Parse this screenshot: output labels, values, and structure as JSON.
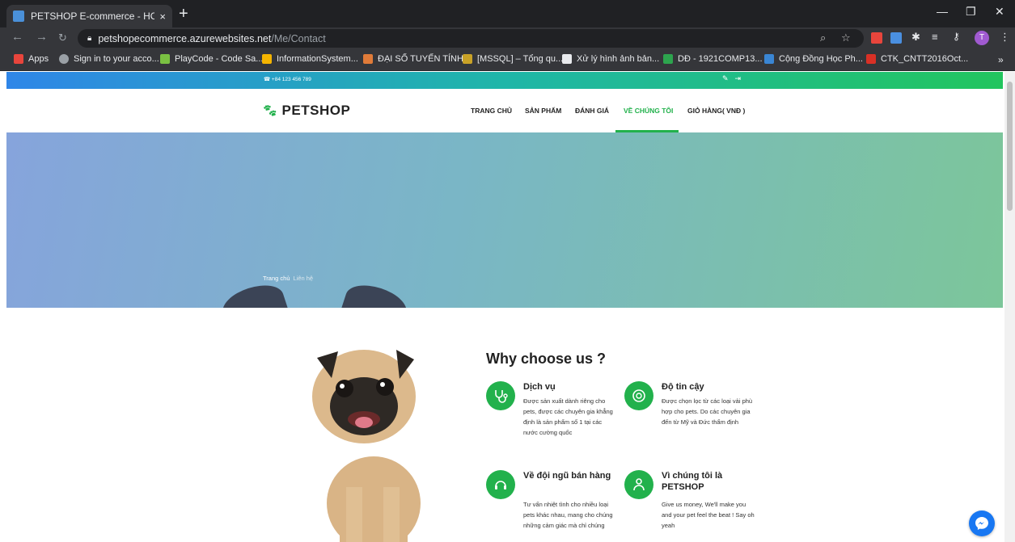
{
  "browser": {
    "tab_title": "PETSHOP E-commerce - HCMUE",
    "tab_close": "×",
    "new_tab": "+",
    "url_host": "petshopecommerce.azurewebsites.net",
    "url_path": "/Me/Contact",
    "window_min": "—",
    "window_max": "❐",
    "window_close": "✕",
    "avatar_letter": "T",
    "bookmarks": [
      {
        "label": "Apps",
        "color": "#e8453c"
      },
      {
        "label": "Sign in to your acco...",
        "color": "#9aa0a6"
      },
      {
        "label": "PlayCode - Code Sa...",
        "color": "#7ac142"
      },
      {
        "label": "InformationSystem...",
        "color": "#f4b400"
      },
      {
        "label": "ĐẠI SỐ TUYẾN TÍNH",
        "color": "#e07b39"
      },
      {
        "label": "[MSSQL] – Tổng qu...",
        "color": "#c9a227"
      },
      {
        "label": "Xử lý hình ảnh bản...",
        "color": "#e8eaed"
      },
      {
        "label": "DĐ - 1921COMP13...",
        "color": "#2da44e"
      },
      {
        "label": "Cộng Đồng Học Ph...",
        "color": "#3a86d4"
      },
      {
        "label": "CTK_CNTT2016Oct...",
        "color": "#d93025"
      },
      {
        "label": "»",
        "color": ""
      }
    ]
  },
  "topbar": {
    "phone": "+84 123 456 789"
  },
  "header": {
    "logo": "PETSHOP",
    "menu": [
      "TRANG CHỦ",
      "SẢN PHẨM",
      "ĐÁNH GIÁ",
      "VỀ CHÚNG TÔI",
      "GIỎ HÀNG( VNĐ )"
    ],
    "active_index": 3
  },
  "hero": {
    "crumb_home": "Trang chủ",
    "crumb_current": "Liên hệ"
  },
  "why": {
    "title": "Why choose us ?",
    "features": [
      {
        "title": "Dịch vụ",
        "desc": "Được sản xuất dành riêng cho pets, được các chuyên gia khẳng định là sản phẩm số 1 tại các nước cường quốc"
      },
      {
        "title": "Độ tin cậy",
        "desc": "Được chọn lọc từ các loại vải phù hợp cho pets. Do các chuyên gia đến từ Mỹ và Đức thẩm định"
      },
      {
        "title": "Về đội ngũ bán hàng",
        "desc": "Tư vấn nhiệt tình cho nhiều loại pets khác nhau, mang cho chúng những cảm giác mà chỉ chúng"
      },
      {
        "title": "Vì chúng tôi là PETSHOP",
        "desc": "Give us money, We'll make you and your pet feel the beat ! Say oh yeah"
      }
    ]
  },
  "colors": {
    "accent": "#22b14c",
    "messenger": "#1877f2"
  }
}
